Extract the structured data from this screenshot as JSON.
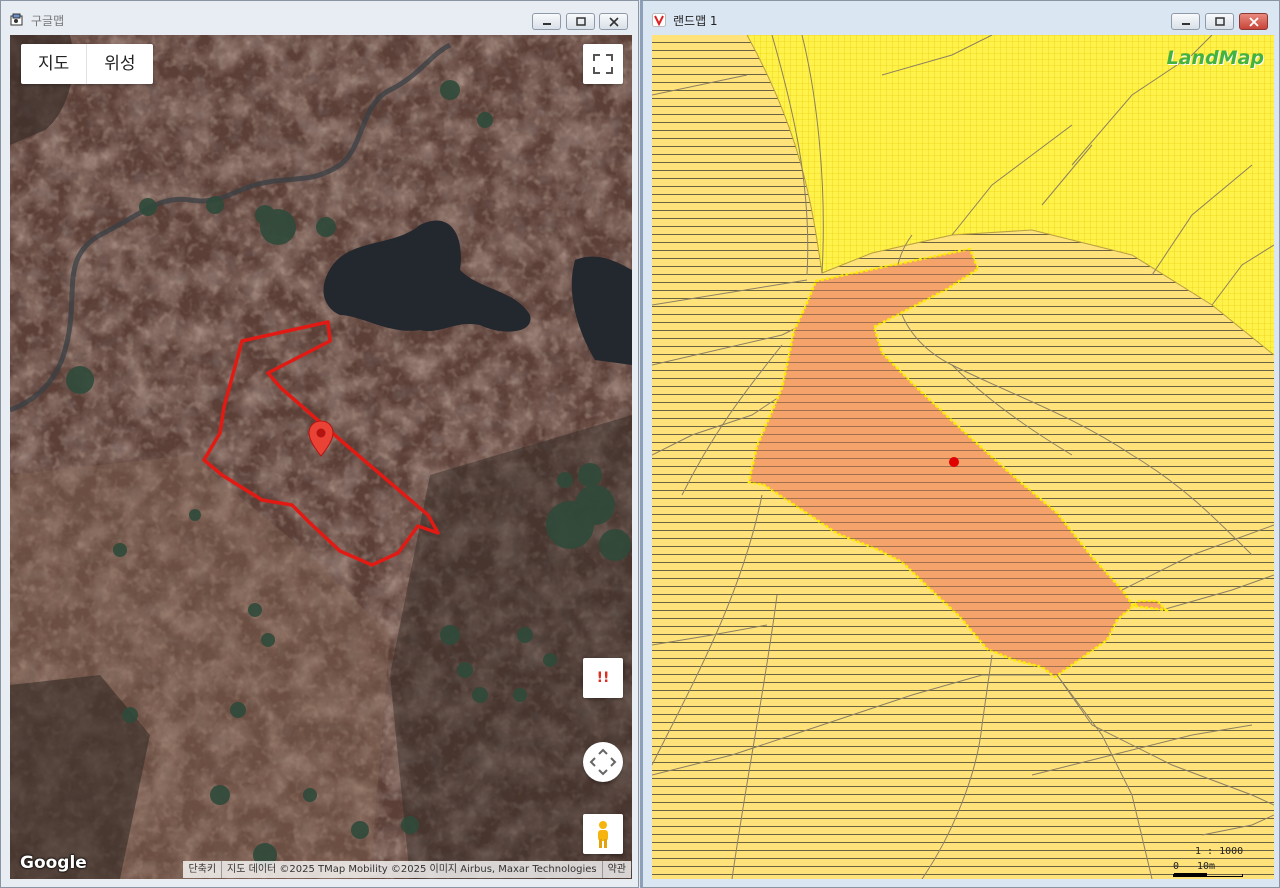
{
  "left_window": {
    "title": "구글맵",
    "map_type_tabs": [
      "지도",
      "위성"
    ],
    "alert_label": "!!",
    "google_logo": "Google",
    "attribution": {
      "shortcuts": "단축키",
      "map_data": "지도 데이터 ©2025 TMap Mobility ©2025 이미지 Airbus, Maxar Technologies",
      "terms": "약관"
    },
    "outline_color": "#e11a14",
    "marker_color": "#ea4335"
  },
  "right_window": {
    "title": "랜드맵 1",
    "logo": "LandMap",
    "scale_ratio": "1 : 1000",
    "scale_zero": "0",
    "scale_length": "10m",
    "parcel_fill_color": "#f5a36a",
    "parcel_border_color": "#ffee00",
    "land_fill_color": "#ffe27a",
    "north_area_color": "#fff24a",
    "center_dot_color": "#e00000"
  }
}
